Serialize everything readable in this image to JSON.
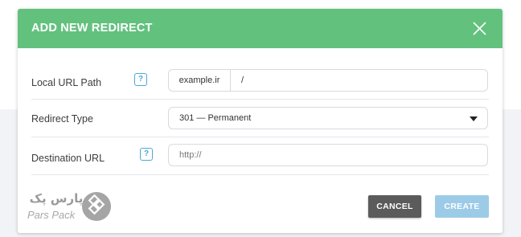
{
  "modal": {
    "title": "ADD NEW REDIRECT"
  },
  "fields": {
    "local_url": {
      "label": "Local URL Path",
      "prefix": "example.ir",
      "value": "/"
    },
    "redirect_type": {
      "label": "Redirect Type",
      "selected": "301 — Permanent"
    },
    "destination": {
      "label": "Destination URL",
      "placeholder": "http://"
    }
  },
  "help_glyph": "?",
  "buttons": {
    "cancel": "CANCEL",
    "create": "CREATE"
  },
  "watermark": {
    "brand_fa": "پارس پک",
    "brand_en": "Pars Pack"
  },
  "colors": {
    "header": "#63c17e",
    "help_icon": "#4ba8d6",
    "cancel_button": "#5b5b5b",
    "create_button": "#9ccbe7"
  },
  "icons": [
    "close-icon",
    "help-icon",
    "caret-down-icon",
    "parspack-logo-icon"
  ]
}
